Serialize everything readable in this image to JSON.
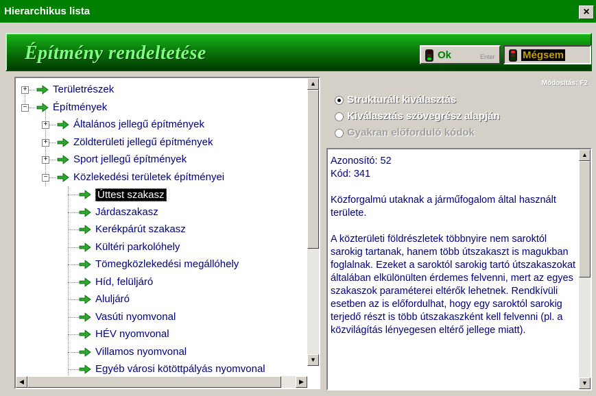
{
  "window": {
    "title": "Hierarchikus lista",
    "close_label": "×"
  },
  "banner": {
    "title": "Építmény rendeltetése"
  },
  "buttons": {
    "ok_label": "Ok",
    "enter_hint": "Enter",
    "cancel_label": "Mégsem"
  },
  "tree": [
    {
      "label": "Területrészek",
      "level": 0,
      "expander": "+"
    },
    {
      "label": "Építmények",
      "level": 0,
      "expander": "−"
    },
    {
      "label": "Általános jellegű építmények",
      "level": 1,
      "expander": "+"
    },
    {
      "label": "Zöldterületi jellegű építmények",
      "level": 1,
      "expander": "+"
    },
    {
      "label": "Sport jellegű építmények",
      "level": 1,
      "expander": "+"
    },
    {
      "label": "Közlekedési területek építményei",
      "level": 1,
      "expander": "−"
    },
    {
      "label": "Úttest szakasz",
      "level": 2,
      "selected": true
    },
    {
      "label": "Járdaszakasz",
      "level": 2
    },
    {
      "label": "Kerékpárút szakasz",
      "level": 2
    },
    {
      "label": "Kültéri parkolóhely",
      "level": 2
    },
    {
      "label": "Tömegközlekedési megállóhely",
      "level": 2
    },
    {
      "label": "Híd, felüljáró",
      "level": 2
    },
    {
      "label": "Aluljáró",
      "level": 2
    },
    {
      "label": "Vasúti nyomvonal",
      "level": 2
    },
    {
      "label": "HÉV nyomvonal",
      "level": 2
    },
    {
      "label": "Villamos nyomvonal",
      "level": 2
    },
    {
      "label": "Egyéb városi kötöttpályás nyomvonal",
      "level": 2
    }
  ],
  "options": {
    "hotkey_hint": "Módosítás: F2",
    "items": [
      {
        "label": "Strukturált kiválasztás",
        "checked": true,
        "enabled": true
      },
      {
        "label": "Kiválasztás szövegrész alapján",
        "checked": false,
        "enabled": true
      },
      {
        "label": "Gyakran előforduló kódok",
        "checked": false,
        "enabled": false
      }
    ]
  },
  "description": {
    "text": "Azonosító: 52\nKód: 341\n\nKözforgalmú utaknak a járműfogalom által használt területe.\n\nA közterületi földrészletek többnyire nem saroktól sarokig tartanak, hanem több útszakaszt is magukban foglalnak. Ezeket a saroktól sarokig tartó útszakaszokat általában elkülönülten érdemes felvenni, mert az egyes szakaszok paraméterei eltérők lehetnek. Rendkívüli esetben az is előfordulhat, hogy egy saroktól sarokig terjedő részt is több útszakaszként kell felvenni (pl. a közvilágítás lényegesen eltérő jellege miatt)."
  },
  "colors": {
    "title_green": "#008000",
    "link_navy": "#000080",
    "arrow_green": "#2ca82c"
  }
}
